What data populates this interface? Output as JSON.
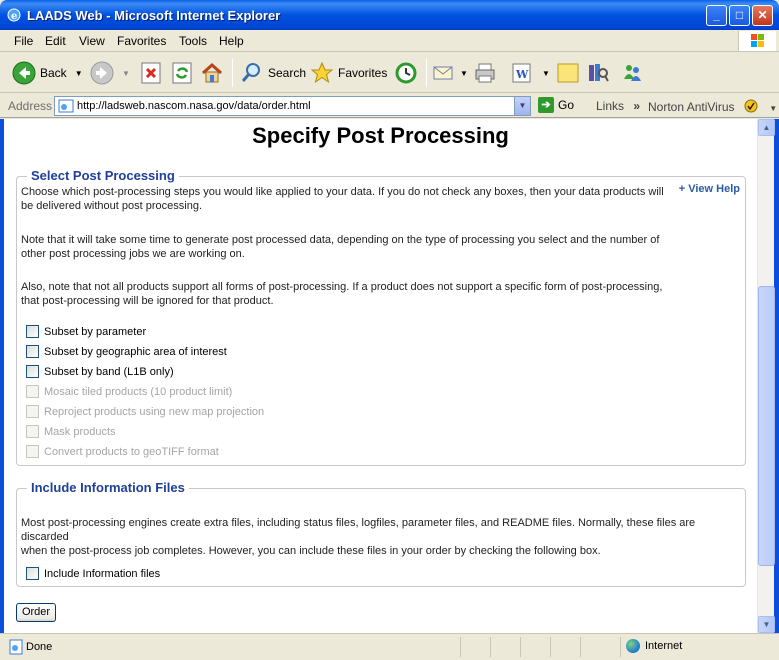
{
  "window": {
    "title": "LAADS Web - Microsoft Internet Explorer"
  },
  "menu": [
    "File",
    "Edit",
    "View",
    "Favorites",
    "Tools",
    "Help"
  ],
  "toolbar": {
    "back_label": "Back",
    "search_label": "Search",
    "favorites_label": "Favorites"
  },
  "address": {
    "label": "Address",
    "url": "http://ladsweb.nascom.nasa.gov/data/order.html",
    "go_label": "Go",
    "links_label": "Links",
    "norton_label": "Norton AntiVirus"
  },
  "page": {
    "title": "Specify Post Processing",
    "post_processing": {
      "legend": "Select Post Processing",
      "view_help": "+ View Help",
      "intro1": "Choose which post-processing steps you would like applied to your data. If you do not check any boxes, then your data products will",
      "intro2": "be delivered without post processing.",
      "note1": "Note that it will take some time to generate post processed data, depending on the type of processing you select and the number of",
      "note2": "other post processing jobs we are working on.",
      "also1": "Also, note that not all products support all forms of post-processing. If a product does not support a specific form of post-processing,",
      "also2": "that post-processing will be ignored for that product.",
      "options": [
        {
          "label": "Subset by parameter",
          "enabled": true,
          "checked": false
        },
        {
          "label": "Subset by geographic area of interest",
          "enabled": true,
          "checked": false
        },
        {
          "label": "Subset by band (L1B only)",
          "enabled": true,
          "checked": false
        },
        {
          "label": "Mosaic tiled products (10 product limit)",
          "enabled": false,
          "checked": false
        },
        {
          "label": "Reproject products using new map projection",
          "enabled": false,
          "checked": false
        },
        {
          "label": "Mask products",
          "enabled": false,
          "checked": false
        },
        {
          "label": "Convert products to geoTIFF format",
          "enabled": false,
          "checked": false
        }
      ]
    },
    "info_files": {
      "legend": "Include Information Files",
      "desc1": "Most post-processing engines create extra files, including status files, logfiles, parameter files, and README files. Normally, these files are discarded",
      "desc2": "when the post-process job completes. However, you can include these files in your order by checking the following box.",
      "option_label": "Include Information files"
    },
    "order_label": "Order"
  },
  "status": {
    "text": "Done",
    "zone": "Internet"
  }
}
